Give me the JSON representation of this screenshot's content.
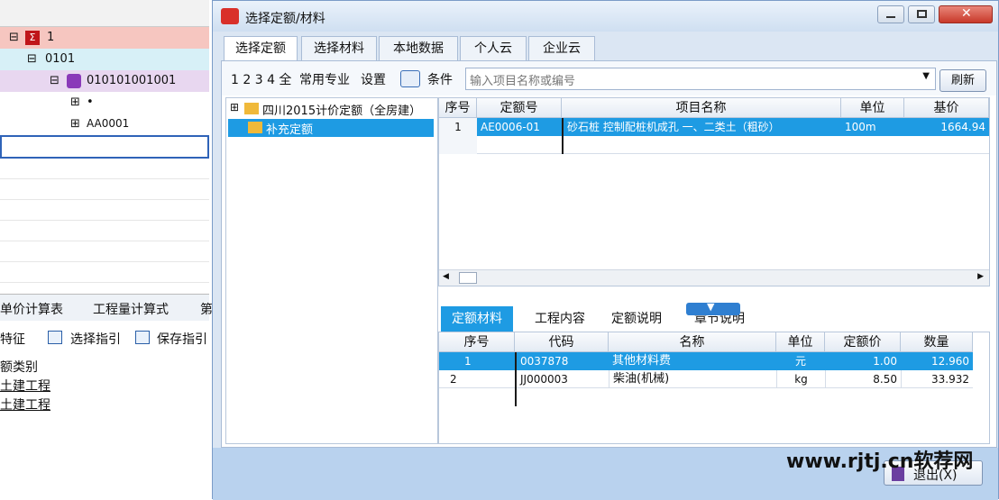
{
  "background_app": {
    "tree": [
      {
        "label": "1",
        "icon": "sum-icon"
      },
      {
        "label": "0101"
      },
      {
        "label": "010101001001",
        "icon": "material-icon"
      },
      {
        "label": "•"
      },
      {
        "label": "AA0001"
      }
    ],
    "bottom_tabs": [
      "单价计算表",
      "工程量计算式",
      "第"
    ],
    "toolbar": [
      "特征",
      "选择指引",
      "保存指引"
    ],
    "side_text": [
      "额类别",
      "土建工程",
      "土建工程"
    ]
  },
  "dialog": {
    "title": "选择定额/材料",
    "tabs": [
      "选择定额",
      "选择材料",
      "本地数据",
      "个人云",
      "企业云"
    ],
    "toolbar": {
      "nums": "1 2 3 4 全",
      "common": "常用专业",
      "settings": "设置",
      "condition": "条件",
      "search_placeholder": "输入项目名称或编号",
      "search_button": "刷新"
    },
    "tree": [
      {
        "label": "四川2015计价定额（全房建）"
      },
      {
        "label": "补充定额"
      }
    ],
    "quota_grid": {
      "headers": [
        "序号",
        "定额号",
        "项目名称",
        "单位",
        "基价"
      ],
      "rows": [
        [
          "1",
          "AE0006-01",
          "砂石桩 控制配桩机成孔 一、二类土（粗砂）",
          "100m",
          "1664.94"
        ]
      ]
    },
    "bottom_tabs": [
      "定额材料",
      "工程内容",
      "定额说明",
      "章节说明"
    ],
    "material_grid": {
      "headers": [
        "序号",
        "代码",
        "名称",
        "单位",
        "定额价",
        "数量"
      ],
      "rows": [
        [
          "1",
          "0037878",
          "其他材料费",
          "元",
          "1.00",
          "12.960"
        ],
        [
          "2",
          "JJ000003",
          "柴油(机械)",
          "kg",
          "8.50",
          "33.932"
        ]
      ]
    },
    "exit_label": "退出(X)"
  },
  "watermark": "www.rjtj.cn软荐网",
  "colors": {
    "selected": "#1e9be3",
    "title_bg": "#dbe6f3",
    "status_bg": "#b9d2ee"
  }
}
